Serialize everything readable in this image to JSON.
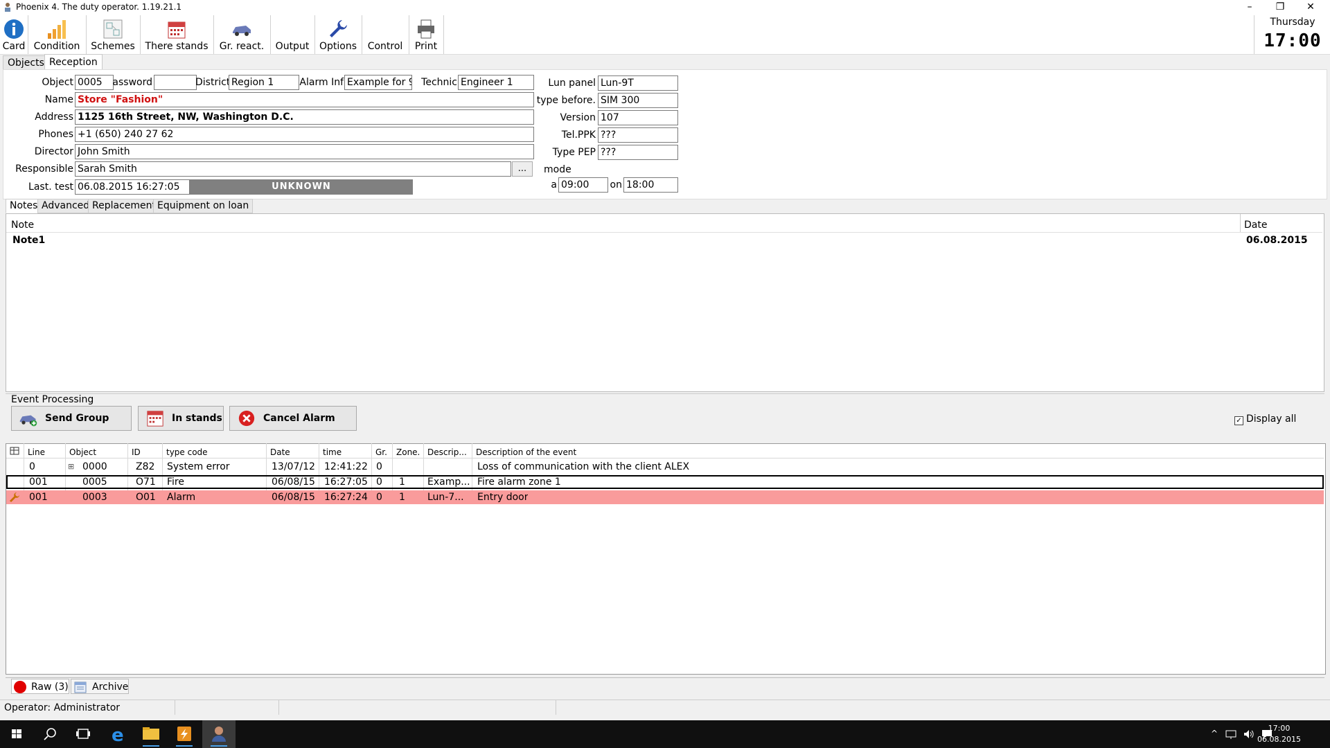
{
  "window": {
    "title": "Phoenix 4. The duty operator. 1.19.21.1",
    "minimize": "–",
    "restore": "❐",
    "close": "✕"
  },
  "toolbar": [
    {
      "label": "Card",
      "icon": "info-icon"
    },
    {
      "label": "Condition",
      "icon": "bar-chart-icon"
    },
    {
      "label": "Schemes",
      "icon": "schemes-icon"
    },
    {
      "label": "There stands",
      "icon": "calendar-icon"
    },
    {
      "label": "Gr. react.",
      "icon": "car-icon"
    },
    {
      "label": "Output",
      "icon": "output-icon"
    },
    {
      "label": "Options",
      "icon": "wrench-icon"
    },
    {
      "label": "Control",
      "icon": "control-icon"
    },
    {
      "label": "Print",
      "icon": "printer-icon"
    }
  ],
  "clock": {
    "day": "Thursday",
    "time": "17:00"
  },
  "main_tabs": [
    "Objects",
    "Reception"
  ],
  "form": {
    "object_label": "Object",
    "object_value": "0005",
    "password_label": "assword",
    "password_value": "",
    "district_label": "District",
    "district_value": "Region 1",
    "alarm_info_label": "Alarm Inf",
    "alarm_info_value": "Example for 9",
    "technic_label": "Technic",
    "technic_value": "Engineer 1",
    "name_label": "Name",
    "name_value": "Store \"Fashion\"",
    "address_label": "Address",
    "address_value": "1125 16th Street, NW, Washington D.C.",
    "phones_label": "Phones",
    "phones_value": "+1 (650) 240 27 62",
    "director_label": "Director",
    "director_value": "John Smith",
    "responsible_label": "Responsible",
    "responsible_value": "Sarah Smith",
    "dots_label": "...",
    "last_test_label": "Last. test",
    "last_test_value": "06.08.2015 16:27:05",
    "status_value": "UNKNOWN",
    "lun_panel_label": "Lun panel",
    "lun_panel_value": "Lun-9T",
    "type_before_label": "type before.",
    "type_before_value": "SIM 300",
    "version_label": "Version",
    "version_value": "107",
    "tel_ppk_label": "Tel.PPK",
    "tel_ppk_value": "???",
    "type_pep_label": "Type PEP",
    "type_pep_value": "???",
    "mode_label": "mode",
    "from_label": "a",
    "from_value": "09:00",
    "to_label": "on",
    "to_value": "18:00"
  },
  "sub_tabs": [
    "Notes",
    "Advanced",
    "Replacement",
    "Equipment on loan"
  ],
  "notes": {
    "headers": {
      "note": "Note",
      "date": "Date"
    },
    "rows": [
      {
        "note": "Note1",
        "date": "06.08.2015"
      }
    ]
  },
  "event_processing": {
    "title": "Event Processing",
    "send_group": "Send Group",
    "in_stands": "In stands",
    "cancel_alarm": "Cancel Alarm",
    "display_all": "Display all",
    "display_all_check": "✓"
  },
  "events": {
    "headers": [
      "Line",
      "Object",
      "ID",
      "type code",
      "Date",
      "time",
      "Gr.",
      "Zone.",
      "Descrip...",
      "Description of the event"
    ],
    "rows": [
      {
        "line": "0",
        "expand": "⊞",
        "object": "0000",
        "id": "Z82",
        "type": "System error",
        "date": "13/07/12",
        "time": "12:41:22",
        "gr": "0",
        "zone": "",
        "descr": "",
        "event": "Loss of communication with the client ALEX"
      },
      {
        "line": "001",
        "expand": "",
        "object": "0005",
        "id": "O71",
        "type": "Fire",
        "date": "06/08/15",
        "time": "16:27:05",
        "gr": "0",
        "zone": "1",
        "descr": "Examp...",
        "event": "Fire alarm zone 1"
      },
      {
        "line": "001",
        "expand": "",
        "object": "0003",
        "id": "O01",
        "type": "Alarm",
        "date": "06/08/15",
        "time": "16:27:24",
        "gr": "0",
        "zone": "1",
        "descr": "Lun-7...",
        "event": "Entry door"
      }
    ]
  },
  "bottom_tabs": {
    "raw": "Raw  (3)",
    "archive": "Archive"
  },
  "status": {
    "operator": "Operator: Administrator"
  },
  "taskbar": {
    "time": "17:00",
    "date": "06.08.2015"
  },
  "colors": {
    "alarm_row": "#f99b9b",
    "name_text": "#d01010",
    "unknown_bg": "#808080"
  }
}
